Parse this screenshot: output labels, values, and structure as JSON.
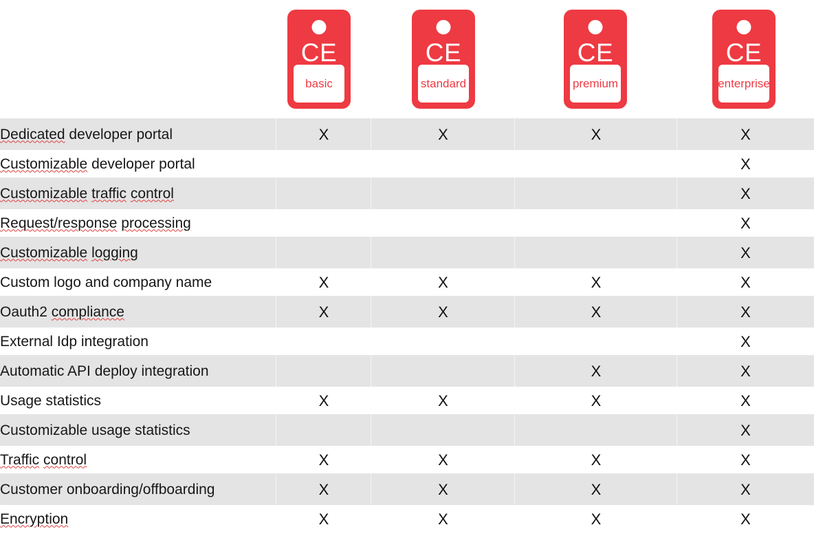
{
  "header": {
    "tiers": [
      {
        "id": "basic",
        "badge_text": "CE",
        "label": "basic",
        "color": "#ee3a42"
      },
      {
        "id": "standard",
        "badge_text": "CE",
        "label": "standard",
        "color": "#ee3a42"
      },
      {
        "id": "premium",
        "badge_text": "CE",
        "label": "premium",
        "color": "#ee3a42"
      },
      {
        "id": "enterprise",
        "badge_text": "CE",
        "label": "enterprise",
        "color": "#ee3a42"
      }
    ]
  },
  "table": {
    "mark": "X",
    "column_labels": [
      "basic",
      "standard",
      "premium",
      "enterprise"
    ],
    "rows": [
      {
        "feature": "Dedicated developer portal",
        "misspelled": [
          "Dedicated"
        ],
        "shaded": true,
        "marks": [
          true,
          true,
          true,
          true
        ]
      },
      {
        "feature": "Customizable developer portal",
        "misspelled": [
          "Customizable"
        ],
        "shaded": false,
        "marks": [
          false,
          false,
          false,
          true
        ]
      },
      {
        "feature": "Customizable traffic control",
        "misspelled": [
          "Customizable",
          "traffic",
          "control"
        ],
        "shaded": true,
        "marks": [
          false,
          false,
          false,
          true
        ]
      },
      {
        "feature": "Request/response processing",
        "misspelled": [
          "Request/response",
          "processing"
        ],
        "shaded": false,
        "marks": [
          false,
          false,
          false,
          true
        ]
      },
      {
        "feature": "Customizable logging",
        "misspelled": [
          "Customizable",
          "logging"
        ],
        "shaded": true,
        "marks": [
          false,
          false,
          false,
          true
        ]
      },
      {
        "feature": "Custom logo and company name",
        "misspelled": [],
        "shaded": false,
        "marks": [
          true,
          true,
          true,
          true
        ]
      },
      {
        "feature": "Oauth2 compliance",
        "misspelled": [
          "compliance"
        ],
        "shaded": true,
        "marks": [
          true,
          true,
          true,
          true
        ]
      },
      {
        "feature": "External Idp integration",
        "misspelled": [],
        "shaded": false,
        "marks": [
          false,
          false,
          false,
          true
        ]
      },
      {
        "feature": "Automatic API deploy integration",
        "misspelled": [],
        "shaded": true,
        "marks": [
          false,
          false,
          true,
          true
        ]
      },
      {
        "feature": "Usage statistics",
        "misspelled": [],
        "shaded": false,
        "marks": [
          true,
          true,
          true,
          true
        ]
      },
      {
        "feature": "Customizable usage statistics",
        "misspelled": [],
        "shaded": true,
        "marks": [
          false,
          false,
          false,
          true
        ]
      },
      {
        "feature": "Traffic control",
        "misspelled": [
          "Traffic",
          "control"
        ],
        "shaded": false,
        "marks": [
          true,
          true,
          true,
          true
        ]
      },
      {
        "feature": "Customer onboarding/offboarding",
        "misspelled": [],
        "shaded": true,
        "marks": [
          true,
          true,
          true,
          true
        ]
      },
      {
        "feature": "Encryption",
        "misspelled": [
          "Encryption"
        ],
        "shaded": false,
        "marks": [
          true,
          true,
          true,
          true
        ]
      }
    ]
  }
}
